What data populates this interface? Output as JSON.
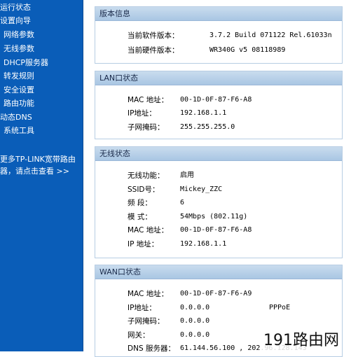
{
  "sidebar": {
    "items": [
      {
        "label": "运行状态"
      },
      {
        "label": "设置向导"
      },
      {
        "label": "网络参数"
      },
      {
        "label": "无线参数"
      },
      {
        "label": "DHCP服务器"
      },
      {
        "label": "转发规则"
      },
      {
        "label": "安全设置"
      },
      {
        "label": "路由功能"
      },
      {
        "label": "动态DNS"
      },
      {
        "label": "系统工具"
      }
    ],
    "promo_line1": "更多TP-LINK宽带路由",
    "promo_line2": "器，请点击查看 >>"
  },
  "version": {
    "title": "版本信息",
    "software_label": "当前软件版本：",
    "software_value": "3.7.2 Build 071122 Rel.61033n",
    "hardware_label": "当前硬件版本：",
    "hardware_value": "WR340G v5 08118989"
  },
  "lan": {
    "title": "LAN口状态",
    "mac_label": "MAC 地址：",
    "mac_value": "00-1D-0F-87-F6-A8",
    "ip_label": "IP地址：",
    "ip_value": "192.168.1.1",
    "mask_label": "子网掩码：",
    "mask_value": "255.255.255.0"
  },
  "wireless": {
    "title": "无线状态",
    "func_label": "无线功能：",
    "func_value": "启用",
    "ssid_label": "SSID号：",
    "ssid_value": "Mickey_ZZC",
    "channel_label": "频 段：",
    "channel_value": "6",
    "mode_label": "模 式：",
    "mode_value": "54Mbps (802.11g)",
    "mac_label": "MAC 地址：",
    "mac_value": "00-1D-0F-87-F6-A8",
    "ip_label": "IP 地址：",
    "ip_value": "192.168.1.1"
  },
  "wan": {
    "title": "WAN口状态",
    "mac_label": "MAC 地址：",
    "mac_value": "00-1D-0F-87-F6-A9",
    "ip_label": "IP地址：",
    "ip_value": "0.0.0.0",
    "conn_type": "PPPoE",
    "mask_label": "子网掩码：",
    "mask_value": "0.0.0.0",
    "gw_label": "网关：",
    "gw_value": "0.0.0.0",
    "dns_label": "DNS 服务器：",
    "dns_value": "61.144.56.100 , 202.96.128.143"
  },
  "watermark": "191路由网",
  "colors": {
    "sidebar_bg": "#0a5db8",
    "panel_header": "#b8d0ea",
    "panel_border": "#b7cde3"
  }
}
